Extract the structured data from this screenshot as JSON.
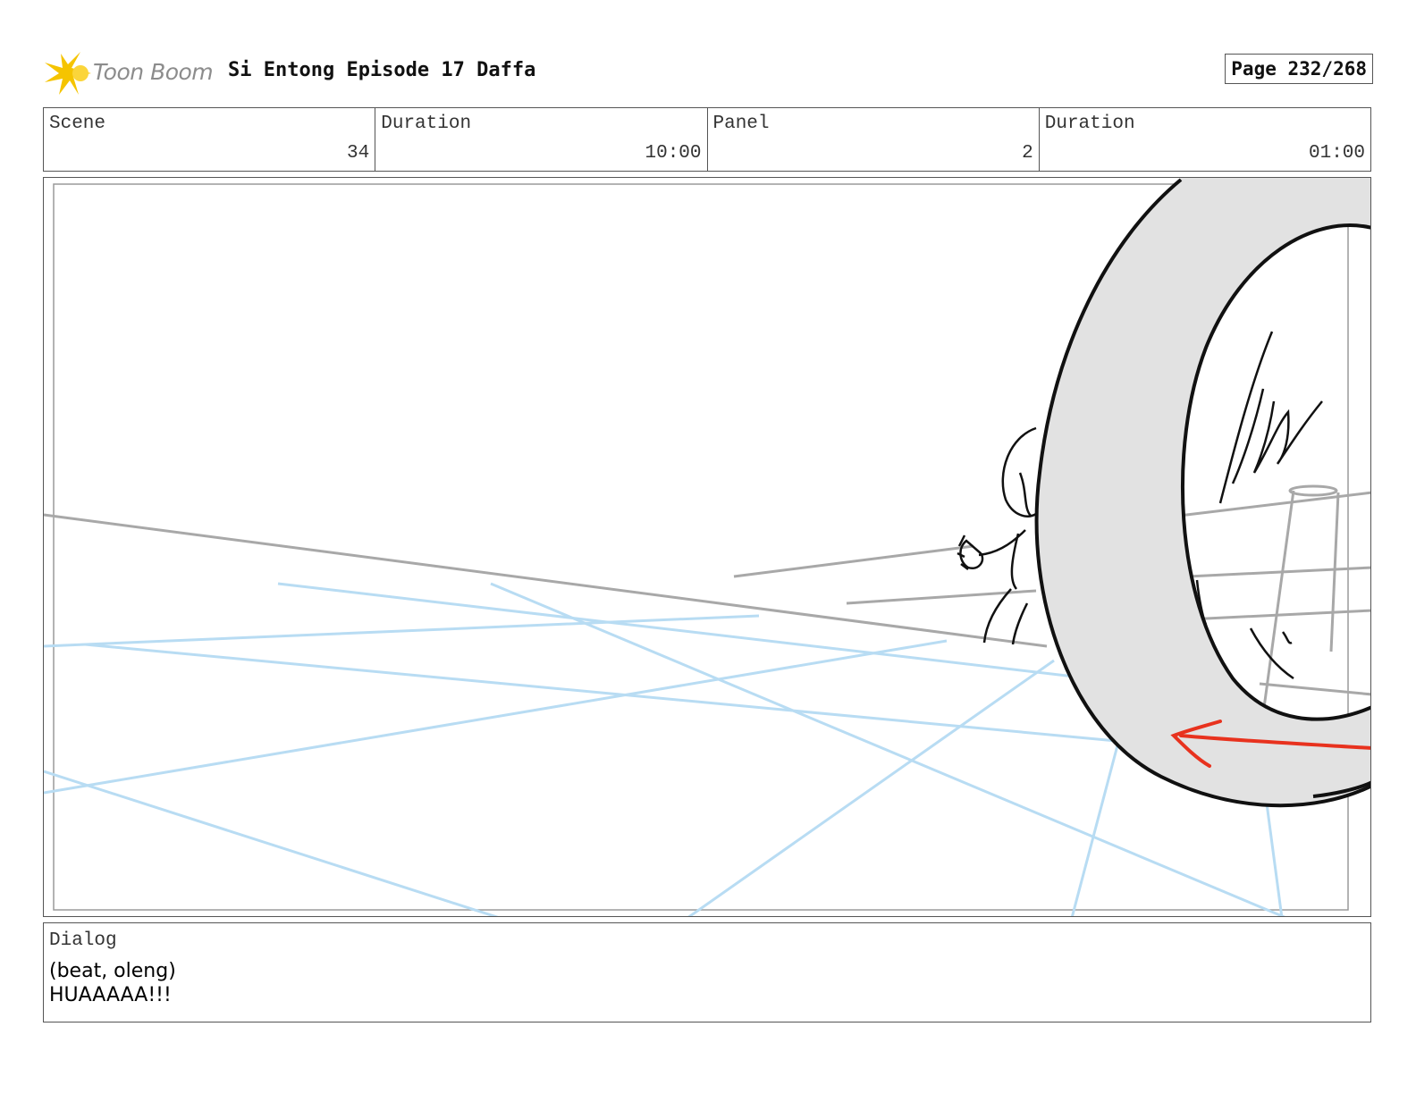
{
  "header": {
    "logo_text": "Toon Boom",
    "title": "Si Entong Episode 17 Daffa",
    "page": "Page 232/268"
  },
  "info": [
    {
      "label": "Scene",
      "value": "34"
    },
    {
      "label": "Duration",
      "value": "10:00"
    },
    {
      "label": "Panel",
      "value": "2"
    },
    {
      "label": "Duration",
      "value": "01:00"
    }
  ],
  "dialog": {
    "label": "Dialog",
    "lines": [
      "(beat, oleng)",
      "HUAAAAA!!!"
    ]
  },
  "colors": {
    "guide_blue": "#b8dcf3",
    "horizon_gray": "#a8a8a8",
    "ring_fill": "#e2e2e2",
    "arrow_red": "#e8321e",
    "logo_yellow": "#f5c400"
  }
}
